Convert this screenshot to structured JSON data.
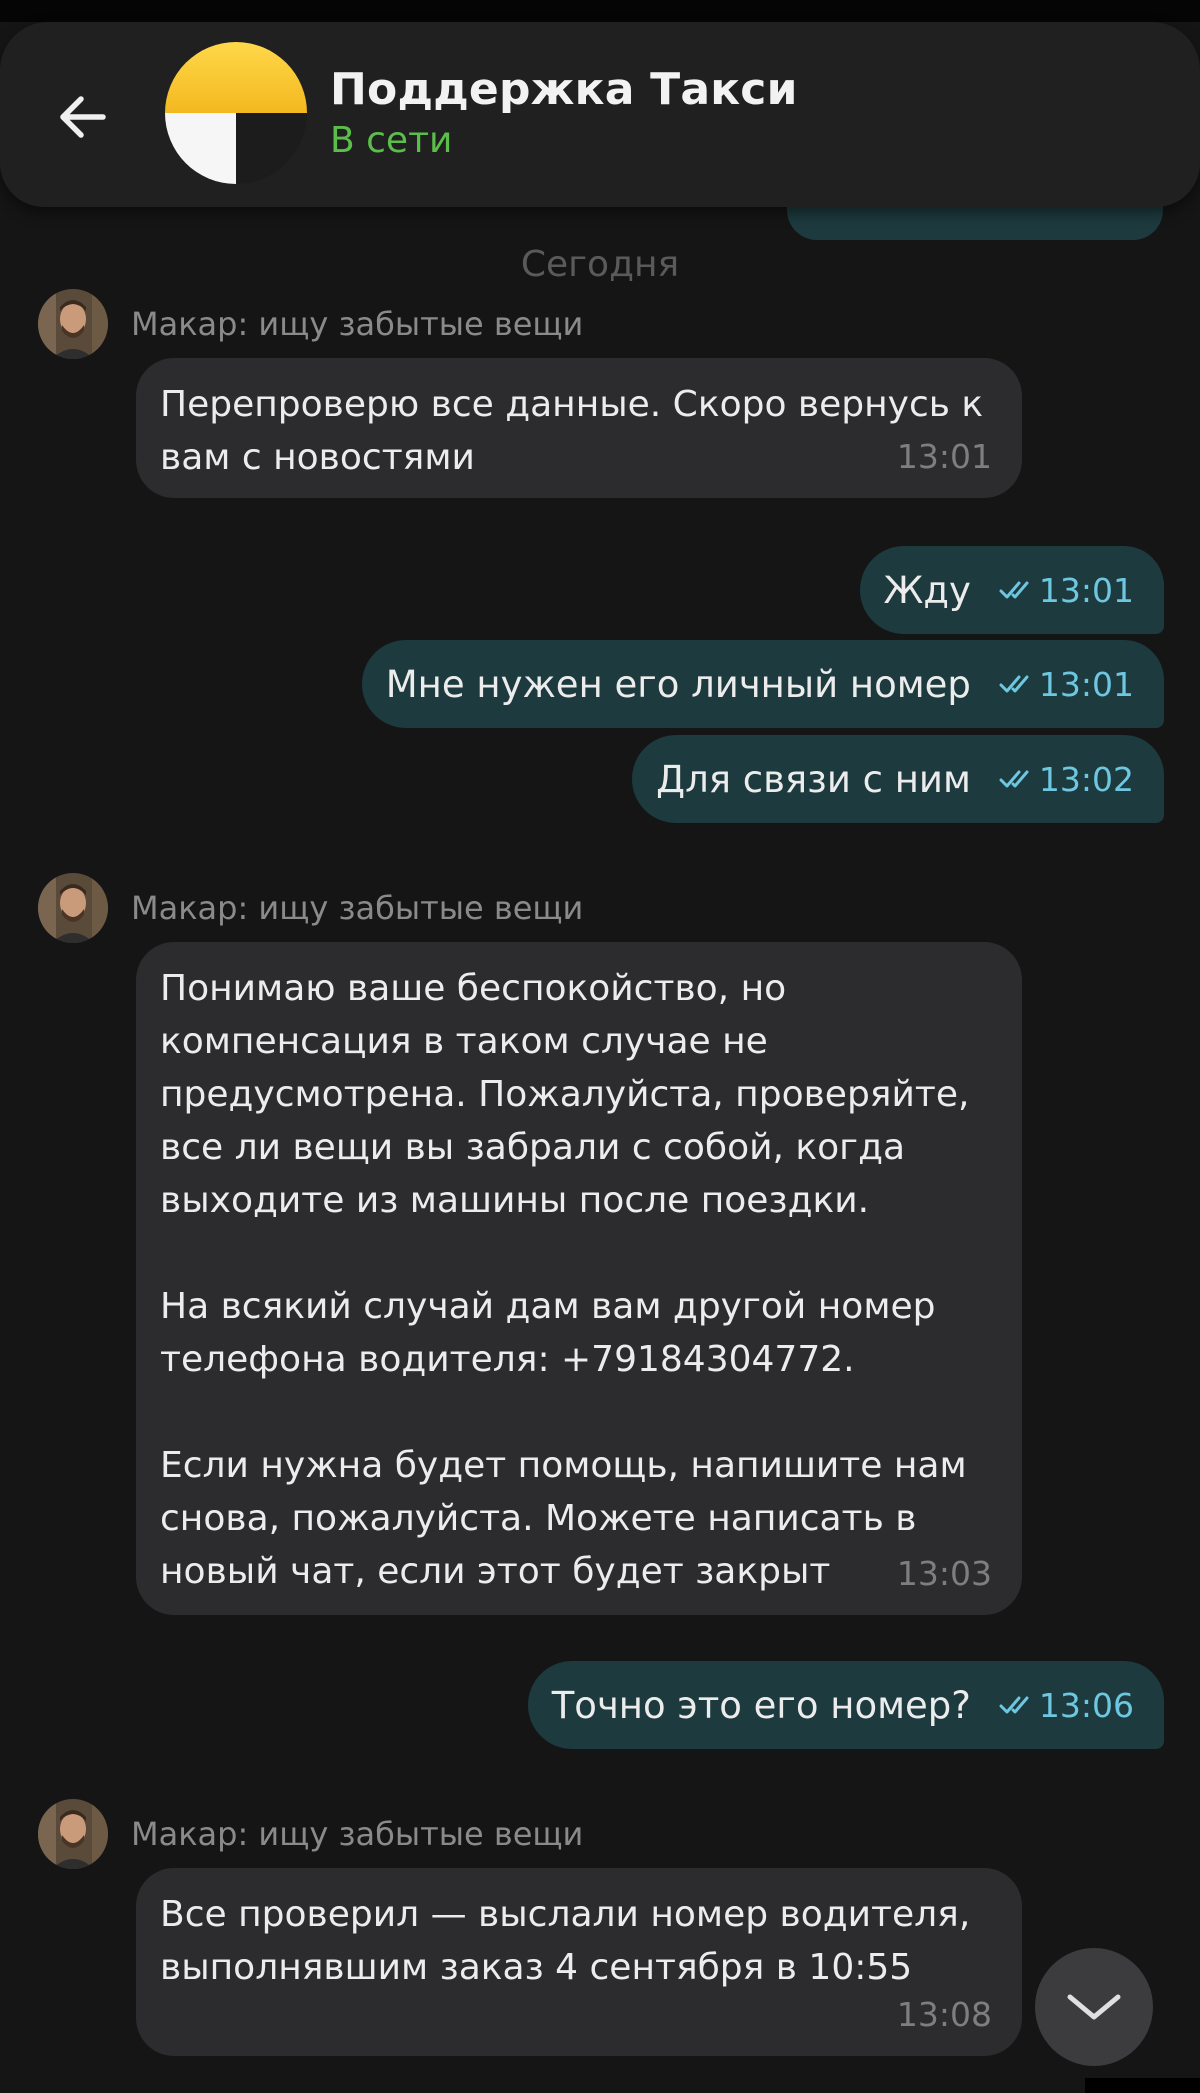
{
  "header": {
    "title": "Поддержка Такси",
    "status": "В сети"
  },
  "date_separator": "Сегодня",
  "messages": [
    {
      "type": "in",
      "sender": "Макар: ищу забытые вещи",
      "text": "Перепроверю все данные. Скоро вернусь к\nвам с новостями",
      "time": "13:01"
    },
    {
      "type": "out",
      "text": "Жду",
      "time": "13:01",
      "status": "read"
    },
    {
      "type": "out",
      "text": "Мне нужен его личный номер",
      "time": "13:01",
      "status": "read"
    },
    {
      "type": "out",
      "text": "Для связи с ним",
      "time": "13:02",
      "status": "read"
    },
    {
      "type": "in",
      "sender": "Макар: ищу забытые вещи",
      "text": "Понимаю ваше беспокойство, но\nкомпенсация в таком случае не\nпредусмотрена. Пожалуйста, проверяйте,\nвсе ли вещи вы забрали с собой, когда\nвыходите из машины после поездки.\n\nНа всякий случай дам вам другой номер\nтелефона водителя: +79184304772.\n\nЕсли нужна будет помощь, напишите нам\nснова, пожалуйста. Можете написать в\nновый чат, если этот будет закрыт",
      "time": "13:03"
    },
    {
      "type": "out",
      "text": "Точно это его номер?",
      "time": "13:06",
      "status": "read"
    },
    {
      "type": "in",
      "sender": "Макар: ищу забытые вещи",
      "text": "Все проверил — выслали номер водителя,\nвыполнявшим заказ 4 сентября в 10:55",
      "time": "13:08"
    }
  ],
  "colors": {
    "background": "#151515",
    "incoming_bubble": "#2c2c2e",
    "outgoing_bubble": "#1d3a3e",
    "online_status": "#5bbd4a",
    "read_check": "#6ec7e0"
  },
  "icons": {
    "back": "arrow-left-icon",
    "read": "double-check-icon",
    "scroll_down": "chevron-down-icon"
  }
}
